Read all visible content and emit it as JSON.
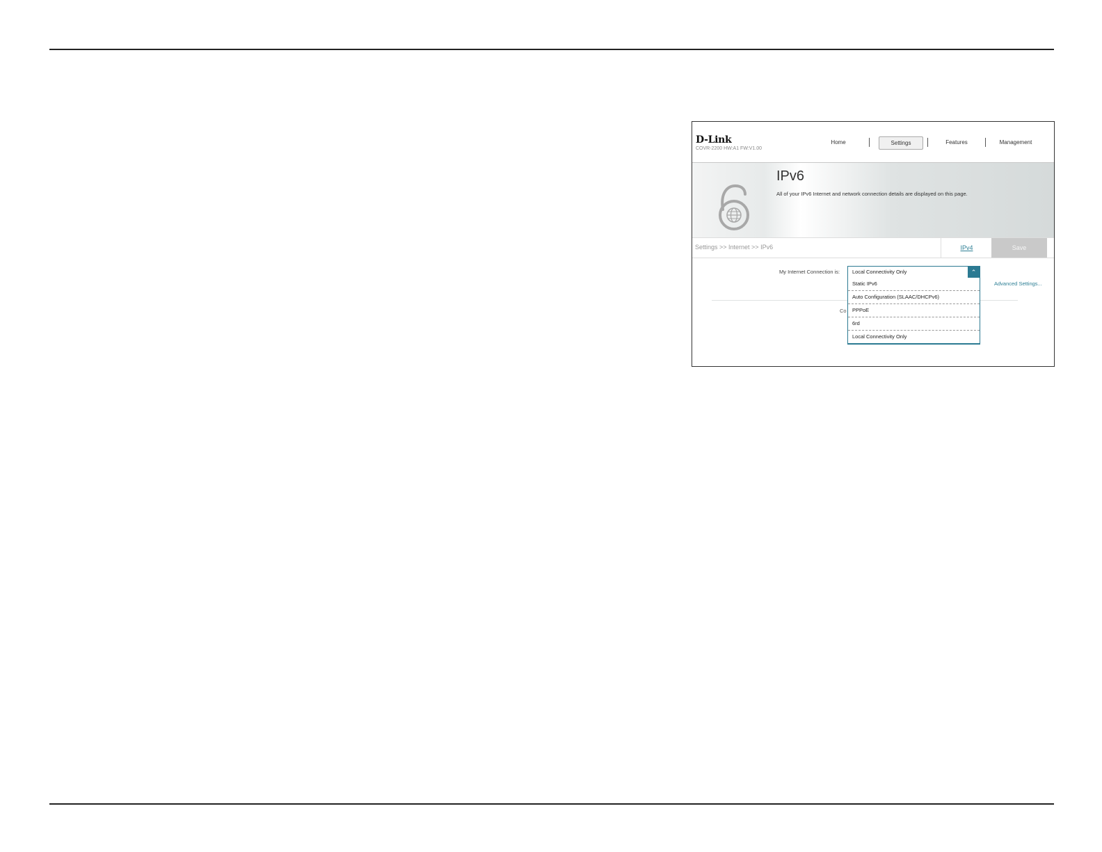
{
  "header": {
    "logo": "D-Link",
    "model": "COVR-2200 HW:A1 FW:V1.00",
    "nav": [
      "Home",
      "Settings",
      "Features",
      "Management"
    ]
  },
  "banner": {
    "title": "IPv6",
    "description": "All of your IPv6 Internet and network connection details are displayed on this page."
  },
  "breadcrumb": "Settings >> Internet >> IPv6",
  "tabs": {
    "ipv4": "IPv4",
    "save": "Save"
  },
  "form": {
    "connection_label": "My Internet Connection is:",
    "selected": "Local Connectivity Only",
    "advanced_link": "Advanced Settings...",
    "partially_hidden_text": "Co",
    "options": [
      "Static IPv6",
      "Auto Configuration (SLAAC/DHCPv6)",
      "PPPoE",
      "6rd",
      "Local Connectivity Only"
    ]
  },
  "colors": {
    "accent": "#2b7a92",
    "save_disabled": "#c9c9c9"
  }
}
